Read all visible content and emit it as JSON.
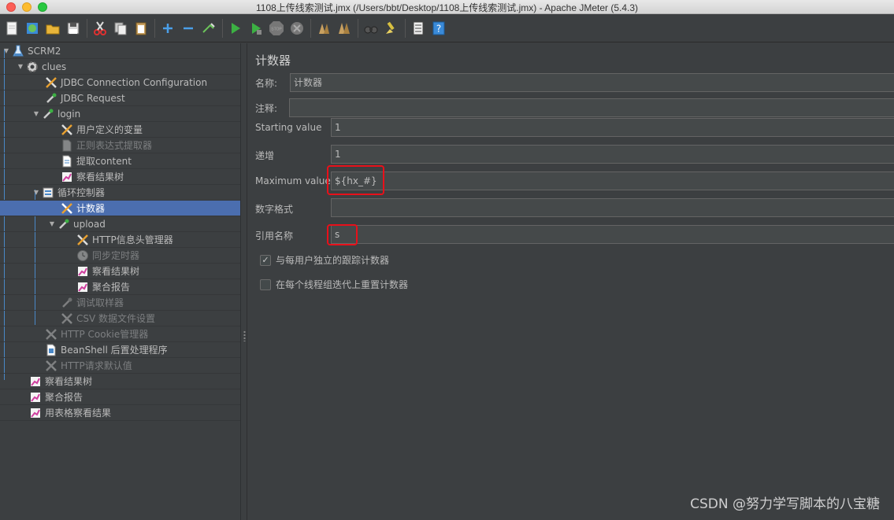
{
  "window": {
    "title": "1108上传线索测试.jmx (/Users/bbt/Desktop/1108上传线索测试.jmx) - Apache JMeter (5.4.3)"
  },
  "toolbar": {
    "buttons": [
      "new-icon",
      "templates-icon",
      "open-icon",
      "save-icon",
      "cut-icon",
      "copy-icon",
      "paste-icon",
      "expand-icon",
      "collapse-icon",
      "toggle-icon",
      "start-icon",
      "start-no-pause-icon",
      "stop-icon",
      "shutdown-icon",
      "clear-icon",
      "clear-all-icon",
      "search-icon",
      "reset-search-icon",
      "function-helper-icon",
      "help-icon"
    ],
    "stop_label": "STOP"
  },
  "tree": {
    "items": [
      {
        "label": "SCRM2",
        "icon": "test-plan-icon"
      },
      {
        "label": "clues",
        "icon": "thread-group-icon"
      },
      {
        "label": "JDBC Connection Configuration",
        "icon": "config-icon"
      },
      {
        "label": "JDBC Request",
        "icon": "sampler-icon"
      },
      {
        "label": "login",
        "icon": "sampler-icon"
      },
      {
        "label": "用户定义的变量",
        "icon": "config-icon"
      },
      {
        "label": "正则表达式提取器",
        "icon": "extractor-icon"
      },
      {
        "label": "提取content",
        "icon": "extractor-icon"
      },
      {
        "label": "察看结果树",
        "icon": "listener-icon"
      },
      {
        "label": "循环控制器",
        "icon": "controller-icon"
      },
      {
        "label": "计数器",
        "icon": "config-icon"
      },
      {
        "label": "upload",
        "icon": "sampler-icon"
      },
      {
        "label": "HTTP信息头管理器",
        "icon": "config-icon"
      },
      {
        "label": "同步定时器",
        "icon": "timer-icon"
      },
      {
        "label": "察看结果树",
        "icon": "listener-icon"
      },
      {
        "label": "聚合报告",
        "icon": "listener-icon"
      },
      {
        "label": "调试取样器",
        "icon": "sampler-icon"
      },
      {
        "label": "CSV 数据文件设置",
        "icon": "config-icon"
      },
      {
        "label": "HTTP Cookie管理器",
        "icon": "config-icon"
      },
      {
        "label": "BeanShell 后置处理程序",
        "icon": "postprocessor-icon"
      },
      {
        "label": "HTTP请求默认值",
        "icon": "config-icon"
      },
      {
        "label": "察看结果树",
        "icon": "listener-icon"
      },
      {
        "label": "聚合报告",
        "icon": "listener-icon"
      },
      {
        "label": "用表格察看结果",
        "icon": "listener-icon"
      }
    ]
  },
  "panel": {
    "title": "计数器",
    "name_label": "名称:",
    "name_value": "计数器",
    "comment_label": "注释:",
    "comment_value": "",
    "start_label": "Starting value",
    "start_value": "1",
    "increment_label": "递增",
    "increment_value": "1",
    "max_label": "Maximum value",
    "max_value": "${hx_#}",
    "format_label": "数字格式",
    "format_value": "",
    "ref_label": "引用名称",
    "ref_value": "s",
    "per_user_label": "与每用户独立的跟踪计数器",
    "per_user_checked": true,
    "reset_label": "在每个线程组迭代上重置计数器",
    "reset_checked": false
  },
  "watermark": "CSDN @努力学写脚本的八宝糖",
  "colors": {
    "selection": "#4b6eaf",
    "highlight": "#e8101a",
    "background": "#3c3f41"
  }
}
